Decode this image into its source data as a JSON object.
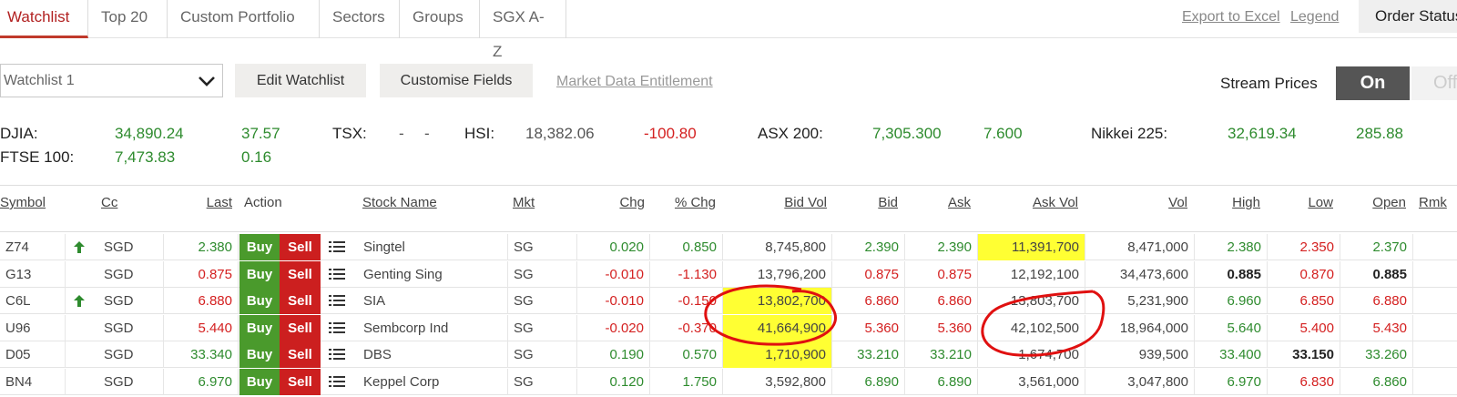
{
  "tabs": [
    "Watchlist",
    "Top 20",
    "Custom Portfolio",
    "Sectors",
    "Groups",
    "SGX A-Z"
  ],
  "top_links": {
    "export": "Export to Excel",
    "legend": "Legend",
    "order_status": "Order Status"
  },
  "toolbar": {
    "watchlist_value": "Watchlist 1",
    "edit_watchlist": "Edit Watchlist",
    "customise_fields": "Customise Fields",
    "market_data": "Market Data Entitlement",
    "stream_label": "Stream Prices",
    "toggle_on": "On",
    "toggle_off": "Off"
  },
  "indices": [
    {
      "name": "DJIA:",
      "last": "34,890.24",
      "chg": "37.57"
    },
    {
      "name": "TSX:",
      "last": "-",
      "chg": "-"
    },
    {
      "name": "HSI:",
      "last": "18,382.06",
      "chg": "-100.80"
    },
    {
      "name": "ASX 200:",
      "last": "7,305.300",
      "chg": "7.600"
    },
    {
      "name": "Nikkei 225:",
      "last": "32,619.34",
      "chg": "285.88"
    },
    {
      "name": "FTSE 100:",
      "last": "7,473.83",
      "chg": "0.16"
    }
  ],
  "columns": {
    "symbol": "Symbol",
    "cc": "Cc",
    "last": "Last",
    "action": "Action",
    "name": "Stock Name",
    "mkt": "Mkt",
    "chg": "Chg",
    "pchg": "% Chg",
    "bidvol": "Bid Vol",
    "bid": "Bid",
    "ask": "Ask",
    "askvol": "Ask Vol",
    "vol": "Vol",
    "high": "High",
    "low": "Low",
    "open": "Open",
    "rmk": "Rmk"
  },
  "action_labels": {
    "buy": "Buy",
    "sell": "Sell"
  },
  "rows": [
    {
      "symbol": "Z74",
      "cc": "SGD",
      "last": "2.380",
      "name": "Singtel",
      "mkt": "SG",
      "chg": "0.020",
      "pchg": "0.850",
      "bidvol": "8,745,800",
      "bid": "2.390",
      "ask": "2.390",
      "askvol": "11,391,700",
      "vol": "8,471,000",
      "high": "2.380",
      "low": "2.350",
      "open": "2.370"
    },
    {
      "symbol": "G13",
      "cc": "SGD",
      "last": "0.875",
      "name": "Genting Sing",
      "mkt": "SG",
      "chg": "-0.010",
      "pchg": "-1.130",
      "bidvol": "13,796,200",
      "bid": "0.875",
      "ask": "0.875",
      "askvol": "12,192,100",
      "vol": "34,473,600",
      "high": "0.885",
      "low": "0.870",
      "open": "0.885"
    },
    {
      "symbol": "C6L",
      "cc": "SGD",
      "last": "6.880",
      "name": "SIA",
      "mkt": "SG",
      "chg": "-0.010",
      "pchg": "-0.150",
      "bidvol": "13,802,700",
      "bid": "6.860",
      "ask": "6.860",
      "askvol": "13,803,700",
      "vol": "5,231,900",
      "high": "6.960",
      "low": "6.850",
      "open": "6.880"
    },
    {
      "symbol": "U96",
      "cc": "SGD",
      "last": "5.440",
      "name": "Sembcorp Ind",
      "mkt": "SG",
      "chg": "-0.020",
      "pchg": "-0.370",
      "bidvol": "41,664,900",
      "bid": "5.360",
      "ask": "5.360",
      "askvol": "42,102,500",
      "vol": "18,964,000",
      "high": "5.640",
      "low": "5.400",
      "open": "5.430"
    },
    {
      "symbol": "D05",
      "cc": "SGD",
      "last": "33.340",
      "name": "DBS",
      "mkt": "SG",
      "chg": "0.190",
      "pchg": "0.570",
      "bidvol": "1,710,900",
      "bid": "33.210",
      "ask": "33.210",
      "askvol": "1,674,700",
      "vol": "939,500",
      "high": "33.400",
      "low": "33.150",
      "open": "33.260"
    },
    {
      "symbol": "BN4",
      "cc": "SGD",
      "last": "6.970",
      "name": "Keppel Corp",
      "mkt": "SG",
      "chg": "0.120",
      "pchg": "1.750",
      "bidvol": "3,592,800",
      "bid": "6.890",
      "ask": "6.890",
      "askvol": "3,561,000",
      "vol": "3,047,800",
      "high": "6.970",
      "low": "6.830",
      "open": "6.860"
    }
  ],
  "colors": {
    "positive": "#2e8b2e",
    "negative": "#d42020",
    "highlight": "#ffff33",
    "annotation": "#e01010"
  }
}
